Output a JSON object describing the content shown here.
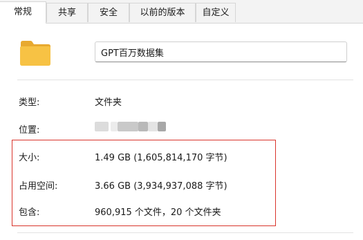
{
  "tabs": [
    {
      "label": "常规",
      "active": true
    },
    {
      "label": "共享",
      "active": false
    },
    {
      "label": "安全",
      "active": false
    },
    {
      "label": "以前的版本",
      "active": false
    },
    {
      "label": "自定义",
      "active": false
    }
  ],
  "folder": {
    "icon": "folder-icon",
    "name": "GPT百万数据集"
  },
  "properties": {
    "type_label": "类型:",
    "type_value": "文件夹",
    "location_label": "位置:",
    "size_label": "大小:",
    "size_value": "1.49 GB (1,605,814,170 字节)",
    "disk_size_label": "占用空间:",
    "disk_size_value": "3.66 GB (3,934,937,088 字节)",
    "contains_label": "包含:",
    "contains_value": "960,915 个文件，20 个文件夹"
  },
  "colors": {
    "highlight": "#d9342b",
    "folder": "#f7c244"
  }
}
